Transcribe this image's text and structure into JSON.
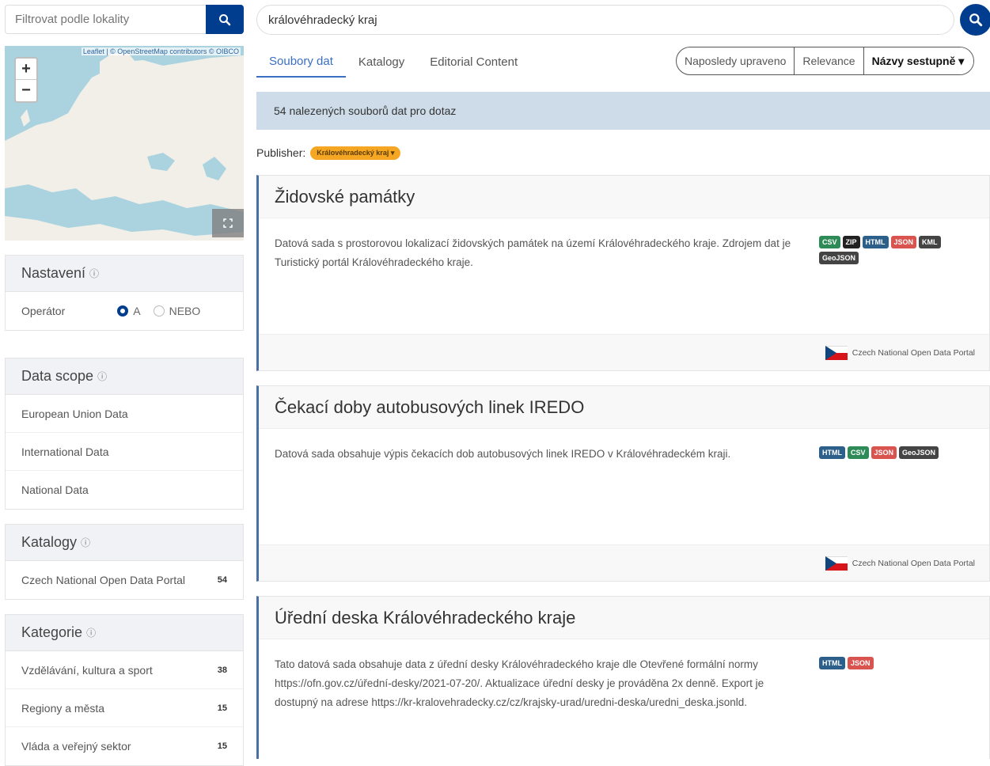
{
  "sidebar": {
    "filter_placeholder": "Filtrovat podle lokality",
    "map": {
      "attribution": "Leaflet | © OpenStreetMap contributors © OIBCO",
      "zoom_in": "+",
      "zoom_out": "−"
    },
    "settings": {
      "title": "Nastavení",
      "operator_label": "Operátor",
      "option_and": "A",
      "option_or": "NEBO"
    },
    "data_scope": {
      "title": "Data scope",
      "items": [
        "European Union Data",
        "International Data",
        "National Data"
      ]
    },
    "catalogs": {
      "title": "Katalogy",
      "items": [
        {
          "label": "Czech National Open Data Portal",
          "count": "54"
        }
      ]
    },
    "categories": {
      "title": "Kategorie",
      "items": [
        {
          "label": "Vzdělávání, kultura a sport",
          "count": "38"
        },
        {
          "label": "Regiony a města",
          "count": "15"
        },
        {
          "label": "Vláda a veřejný sektor",
          "count": "15"
        }
      ]
    }
  },
  "search": {
    "value": "královéhradecký kraj"
  },
  "tabs": [
    "Soubory dat",
    "Katalogy",
    "Editorial Content"
  ],
  "sort": [
    "Naposledy upraveno",
    "Relevance",
    "Názvy sestupně ▾"
  ],
  "result_count_text": "54 nalezených souborů dat pro dotaz",
  "publisher": {
    "label": "Publisher:",
    "value": "Královéhradecký kraj",
    "chevron": "▾"
  },
  "datasets": [
    {
      "title": "Židovské památky",
      "description": "Datová sada s prostorovou lokalizací židovských památek na území Královéhradeckého kraje. Zdrojem dat je Turistický portál Královéhradeckého kraje.",
      "formats": [
        {
          "label": "CSV",
          "color": "#2e8b57"
        },
        {
          "label": "ZIP",
          "color": "#222222"
        },
        {
          "label": "HTML",
          "color": "#2c5f8a"
        },
        {
          "label": "JSON",
          "color": "#d9534f"
        },
        {
          "label": "KML",
          "color": "#444444"
        },
        {
          "label": "GeoJSON",
          "color": "#444444"
        }
      ],
      "catalog": "Czech National Open Data Portal"
    },
    {
      "title": "Čekací doby autobusových linek IREDO",
      "description": "Datová sada obsahuje výpis čekacích dob autobusových linek IREDO v Královéhradeckém kraji.",
      "formats": [
        {
          "label": "HTML",
          "color": "#2c5f8a"
        },
        {
          "label": "CSV",
          "color": "#2e8b57"
        },
        {
          "label": "JSON",
          "color": "#d9534f"
        },
        {
          "label": "GeoJSON",
          "color": "#444444"
        }
      ],
      "catalog": "Czech National Open Data Portal"
    },
    {
      "title": "Úřední deska Královéhradeckého kraje",
      "description": "Tato datová sada obsahuje data z úřední desky Královéhradeckého kraje dle Otevřené formální normy https://ofn.gov.cz/úřední-desky/2021-07-20/. Aktualizace úřední desky je prováděna 2x denně. Export je dostupný na adrese https://kr-kralovehradecky.cz/cz/krajsky-urad/uredni-deska/uredni_deska.jsonld.",
      "formats": [
        {
          "label": "HTML",
          "color": "#2c5f8a"
        },
        {
          "label": "JSON",
          "color": "#d9534f"
        }
      ]
    }
  ]
}
